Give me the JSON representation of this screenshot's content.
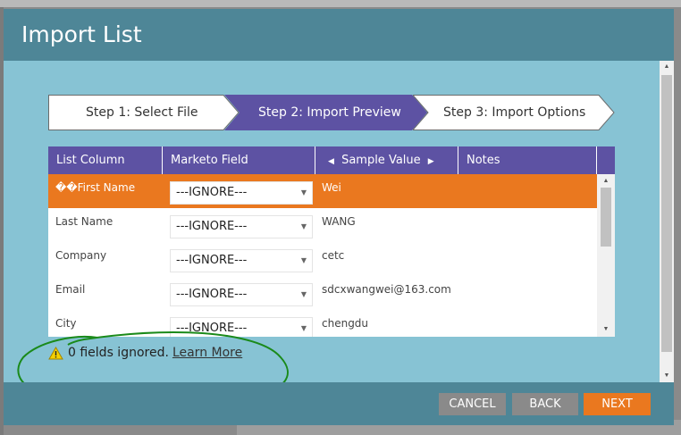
{
  "dialog": {
    "title": "Import List"
  },
  "steps": [
    {
      "label": "Step 1: Select File",
      "active": false
    },
    {
      "label": "Step 2: Import Preview",
      "active": true
    },
    {
      "label": "Step 3: Import Options",
      "active": false
    }
  ],
  "table": {
    "headers": {
      "list_column": "List Column",
      "marketo_field": "Marketo Field",
      "sample_value": "Sample Value",
      "notes": "Notes"
    },
    "rows": [
      {
        "name": "��First Name",
        "field": "---IGNORE---",
        "sample": "Wei",
        "selected": true
      },
      {
        "name": "Last Name",
        "field": "---IGNORE---",
        "sample": "WANG"
      },
      {
        "name": "Company",
        "field": "---IGNORE---",
        "sample": "cetc"
      },
      {
        "name": "Email",
        "field": "---IGNORE---",
        "sample": "sdcxwangwei@163.com"
      },
      {
        "name": "City",
        "field": "---IGNORE---",
        "sample": "chengdu"
      }
    ]
  },
  "warning": {
    "text": "0 fields ignored.",
    "link": "Learn More"
  },
  "buttons": {
    "cancel": "CANCEL",
    "back": "BACK",
    "next": "NEXT"
  },
  "colors": {
    "header": "#4e8697",
    "body": "#87c3d4",
    "accent": "#ea781f",
    "table_header": "#5d52a3",
    "step_active": "#5d52a3"
  }
}
